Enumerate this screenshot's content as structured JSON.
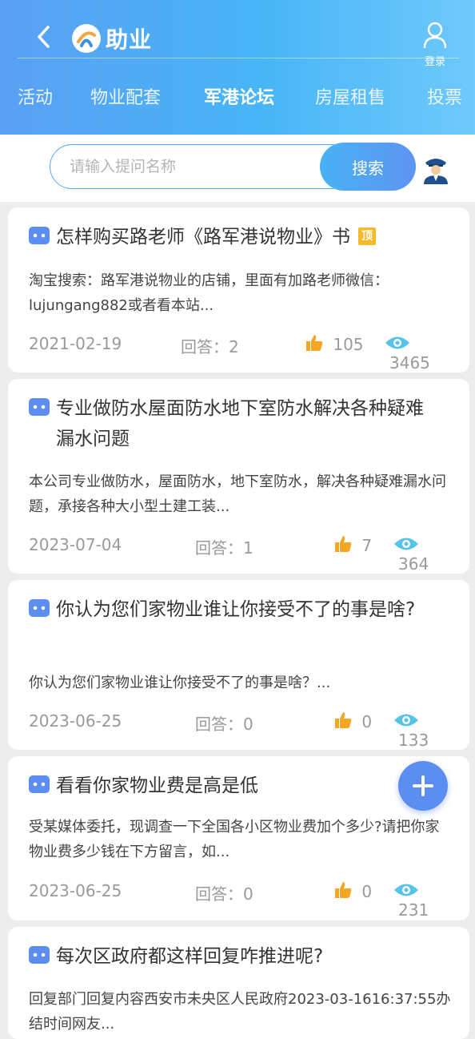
{
  "header": {
    "app_name": "助业",
    "login_label": "登录",
    "tabs": [
      {
        "label": "活动",
        "active": false
      },
      {
        "label": "物业配套",
        "active": false
      },
      {
        "label": "军港论坛",
        "active": true
      },
      {
        "label": "房屋租售",
        "active": false
      },
      {
        "label": "投票",
        "active": false
      }
    ]
  },
  "search": {
    "placeholder": "请输入提问名称",
    "button_label": "搜索"
  },
  "posts": [
    {
      "title": "怎样购买路老师《路军港说物业》书",
      "pinned": true,
      "pinned_label": "顶",
      "desc": "淘宝搜索：路军港说物业的店铺，里面有加路老师微信：lujungang882或者看本站...",
      "date": "2021-02-19",
      "answers": "回答：2",
      "likes": "105",
      "views": "3465"
    },
    {
      "title": "专业做防水屋面防水地下室防水解决各种疑难漏水问题",
      "pinned": false,
      "desc": "本公司专业做防水，屋面防水，地下室防水，解决各种疑难漏水问题，承接各种大小型土建工装...",
      "date": "2023-07-04",
      "answers": "回答：1",
      "likes": "7",
      "views": "364"
    },
    {
      "title": "你认为您们家物业谁让你接受不了的事是啥?",
      "pinned": false,
      "desc": "你认为您们家物业谁让你接受不了的事是啥？...",
      "date": "2023-06-25",
      "answers": "回答：0",
      "likes": "0",
      "views": "133"
    },
    {
      "title": "看看你家物业费是高是低",
      "pinned": false,
      "desc": "受某媒体委托，现调查一下全国各小区物业费加个多少?请把你家物业费多少钱在下方留言，如...",
      "date": "2023-06-25",
      "answers": "回答：0",
      "likes": "0",
      "views": "231"
    },
    {
      "title": "每次区政府都这样回复咋推进呢?",
      "pinned": false,
      "desc": "回复部门回复内容西安市未央区人民政府2023-03-1616:37:55办结时间网友...",
      "date": "",
      "answers": "",
      "likes": "",
      "views": ""
    }
  ],
  "icons": {
    "back": "chevron-left-icon",
    "login": "user-icon",
    "officer": "officer-icon",
    "post": "chat-bubble-icon",
    "like": "thumbs-up-icon",
    "view": "eye-icon",
    "add": "plus-icon"
  },
  "colors": {
    "header_gradient_start": "#5aa0f4",
    "header_gradient_end": "#6fc9fb",
    "accent": "#5b8ef0",
    "like": "#f5a623",
    "view": "#58c3e8",
    "badge": "#f6b92b"
  }
}
